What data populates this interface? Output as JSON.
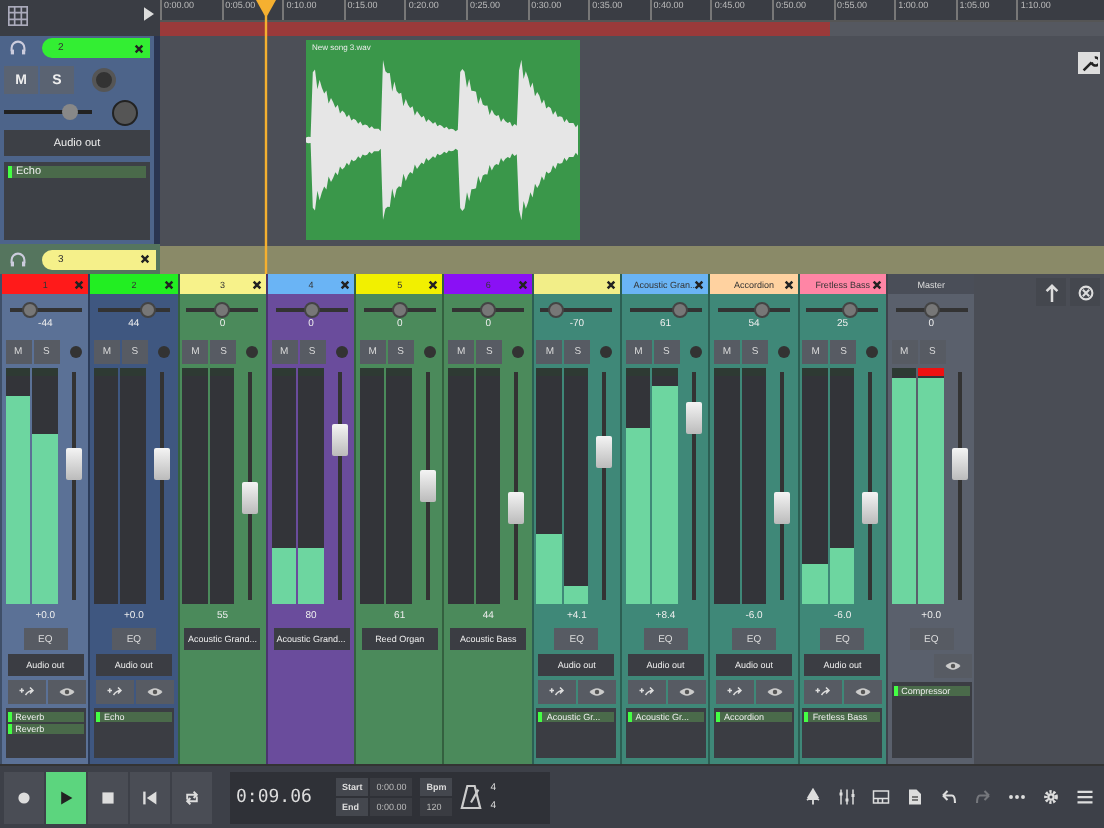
{
  "ruler": [
    "0:00.00",
    "0:05.00",
    "0:10.00",
    "0:15.00",
    "0:20.00",
    "0:25.00",
    "0:30.00",
    "0:35.00",
    "0:40.00",
    "0:45.00",
    "0:50.00",
    "0:55.00",
    "1:00.00",
    "1:05.00",
    "1:10.00"
  ],
  "tracks": [
    {
      "number": "2",
      "color": "#33ee33",
      "mute": "M",
      "solo": "S",
      "volume": {
        "level": 0.75
      },
      "output": "Audio out",
      "inserts": [
        "Echo"
      ],
      "clip": "New song 3.wav"
    },
    {
      "number": "3",
      "color": "#f5f08a"
    }
  ],
  "strips": [
    {
      "kind": "audio",
      "label": "1",
      "color": "#ff1a1a",
      "body": {
        "color": "#5b7196"
      },
      "pan_value": "-44",
      "pan": {
        "level": 0.3
      },
      "mute": "M",
      "solo": "S",
      "meters": [
        {
          "level": 0.88
        },
        {
          "level": 0.72
        }
      ],
      "fader": {
        "level": 0.6
      },
      "clip": false,
      "gain": "+0.0",
      "eq": "EQ",
      "output": "Audio out",
      "inserts": [
        "Reverb",
        "Reverb"
      ]
    },
    {
      "kind": "audio",
      "label": "2",
      "color": "#22ee22",
      "body": {
        "color": "#3f5780"
      },
      "pan_value": "44",
      "pan": {
        "level": 0.7
      },
      "mute": "M",
      "solo": "S",
      "meters": [
        {
          "level": 0.0
        },
        {
          "level": 0.0
        }
      ],
      "fader": {
        "level": 0.6
      },
      "clip": false,
      "gain": "+0.0",
      "eq": "EQ",
      "output": "Audio out",
      "inserts": [
        "Echo"
      ]
    },
    {
      "kind": "midi",
      "label": "3",
      "color": "#f7f28a",
      "body": {
        "color": "#4b8a5b"
      },
      "pan_value": "0",
      "pan": {
        "level": 0.5
      },
      "mute": "M",
      "solo": "S",
      "meters": [
        {
          "level": 0.0
        },
        {
          "level": 0.0
        }
      ],
      "fader": {
        "level": 0.45
      },
      "clip": false,
      "gain": "55",
      "output": "Acoustic Grand..."
    },
    {
      "kind": "midi",
      "label": "4",
      "color": "#6ab4f5",
      "body": {
        "color": "#6a4c9c"
      },
      "pan_value": "0",
      "pan": {
        "level": 0.5
      },
      "mute": "M",
      "solo": "S",
      "meters": [
        {
          "level": 0.24
        },
        {
          "level": 0.24
        }
      ],
      "fader": {
        "level": 0.7
      },
      "clip": false,
      "gain": "80",
      "output": "Acoustic Grand..."
    },
    {
      "kind": "midi",
      "label": "5",
      "color": "#f2f000",
      "body": {
        "color": "#4b8a5b"
      },
      "pan_value": "0",
      "pan": {
        "level": 0.5
      },
      "mute": "M",
      "solo": "S",
      "meters": [
        {
          "level": 0.0
        },
        {
          "level": 0.0
        }
      ],
      "fader": {
        "level": 0.5
      },
      "clip": false,
      "gain": "61",
      "output": "Reed Organ"
    },
    {
      "kind": "midi",
      "label": "6",
      "color": "#8a10f5",
      "body": {
        "color": "#4b8a5b"
      },
      "pan_value": "0",
      "pan": {
        "level": 0.5
      },
      "mute": "M",
      "solo": "S",
      "meters": [
        {
          "level": 0.0
        },
        {
          "level": 0.0
        }
      ],
      "fader": {
        "level": 0.4
      },
      "clip": false,
      "gain": "44",
      "output": "Acoustic Bass"
    },
    {
      "kind": "audio",
      "color": "#f2ee88",
      "body": {
        "color": "#3f8878"
      },
      "pan_value": "-70",
      "pan": {
        "level": 0.2
      },
      "mute": "M",
      "solo": "S",
      "meters": [
        {
          "level": 0.3
        },
        {
          "level": 0.08
        }
      ],
      "fader": {
        "level": 0.65
      },
      "clip": false,
      "gain": "+4.1",
      "eq": "EQ",
      "output": "Audio out",
      "inserts": [
        "Acoustic Gr..."
      ]
    },
    {
      "kind": "audio",
      "label": "Acoustic Gran...",
      "color": "#6ab4f5",
      "body": {
        "color": "#3f8878"
      },
      "pan_value": "61",
      "pan": {
        "level": 0.7
      },
      "mute": "M",
      "solo": "S",
      "meters": [
        {
          "level": 0.75
        },
        {
          "level": 0.92
        }
      ],
      "fader": {
        "level": 0.8
      },
      "clip": false,
      "gain": "+8.4",
      "eq": "EQ",
      "output": "Audio out",
      "inserts": [
        "Acoustic Gr..."
      ]
    },
    {
      "kind": "audio",
      "label": "Accordion",
      "color": "#ffd2a0",
      "body": {
        "color": "#3f8878"
      },
      "pan_value": "54",
      "pan": {
        "level": 0.6
      },
      "mute": "M",
      "solo": "S",
      "meters": [
        {
          "level": 0.0
        },
        {
          "level": 0.0
        }
      ],
      "fader": {
        "level": 0.4
      },
      "clip": false,
      "gain": "-6.0",
      "eq": "EQ",
      "output": "Audio out",
      "inserts": [
        "Accordion"
      ]
    },
    {
      "kind": "audio",
      "label": "Fretless Bass",
      "color": "#ff85a5",
      "body": {
        "color": "#3f8878"
      },
      "pan_value": "25",
      "pan": {
        "level": 0.6
      },
      "mute": "M",
      "solo": "S",
      "meters": [
        {
          "level": 0.17
        },
        {
          "level": 0.24
        }
      ],
      "fader": {
        "level": 0.4
      },
      "clip": false,
      "gain": "-6.0",
      "eq": "EQ",
      "output": "Audio out",
      "inserts": [
        "Fretless Bass"
      ]
    },
    {
      "kind": "master",
      "label": "Master",
      "color": "#4a4e58",
      "body": {
        "color": "#5a606c"
      },
      "pan_value": "0",
      "pan": {
        "level": 0.5
      },
      "mute": "M",
      "solo": "S",
      "meters": [
        {
          "level": 0.96
        },
        {
          "level": 0.96
        }
      ],
      "fader": {
        "level": 0.6
      },
      "clip": true,
      "gain": "+0.0",
      "eq": "EQ",
      "inserts": [
        "Compressor"
      ]
    }
  ],
  "transport": [
    {
      "kind": "record",
      "selected": false
    },
    {
      "kind": "play",
      "selected": true
    },
    {
      "kind": "stop",
      "selected": false
    },
    {
      "kind": "rewind",
      "selected": false
    },
    {
      "kind": "loop",
      "selected": false
    }
  ],
  "time": "0:09.06",
  "start_label": "Start",
  "start": "0:00.00",
  "end_label": "End",
  "end": "0:00.00",
  "bpm_label": "Bpm",
  "bpm": "120",
  "signature": [
    "4",
    "4"
  ],
  "tools": [
    {
      "kind": "tree",
      "disabled": false
    },
    {
      "kind": "mixer",
      "disabled": false
    },
    {
      "kind": "keyboard",
      "disabled": false
    },
    {
      "kind": "document",
      "disabled": false
    },
    {
      "kind": "undo",
      "disabled": false
    },
    {
      "kind": "redo",
      "disabled": true
    },
    {
      "kind": "more",
      "disabled": false
    },
    {
      "kind": "settings",
      "disabled": false
    },
    {
      "kind": "menu",
      "disabled": false
    }
  ]
}
